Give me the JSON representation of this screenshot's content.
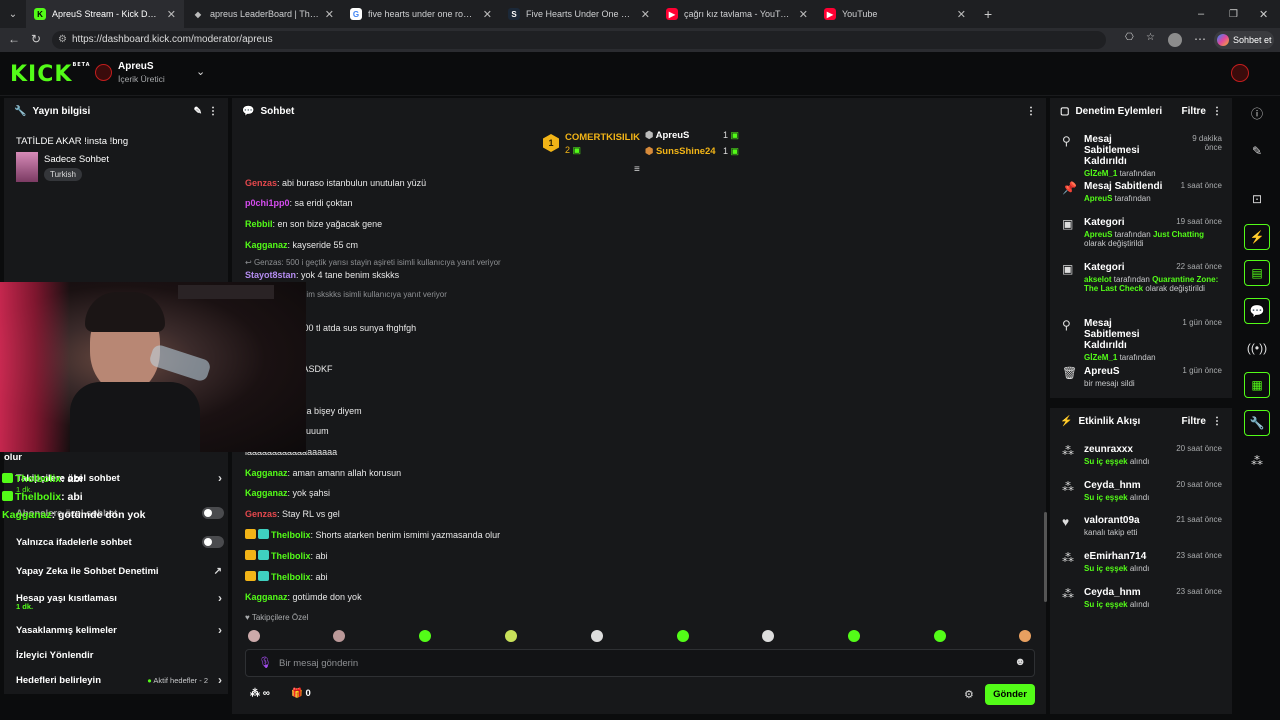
{
  "tabs": [
    {
      "title": "ApreuS Stream - Kick Dashboard",
      "icon": "kick-icon",
      "active": true
    },
    {
      "title": "apreus LeaderBoard | The best Ch",
      "icon": "shield-icon"
    },
    {
      "title": "five hearts under one roof 2 - Goo",
      "icon": "google-icon"
    },
    {
      "title": "Five Hearts Under One Roof seaso",
      "icon": "steam-icon"
    },
    {
      "title": "çağrı kız tavlama - YouTube",
      "icon": "youtube-icon"
    },
    {
      "title": "YouTube",
      "icon": "youtube-icon"
    }
  ],
  "address": {
    "url": "https://dashboard.kick.com/moderator/apreus",
    "chat_button": "Sohbet et"
  },
  "header": {
    "logo": "KICK",
    "beta": "BETA",
    "channel": "ApreuS",
    "role": "İçerik Üretici"
  },
  "stream_info": {
    "title": "Yayın bilgisi",
    "stream_title": "TATİLDE AKAR !insta !bng",
    "category": "Sadece Sohbet",
    "tag": "Turkish"
  },
  "settings": {
    "overlay_lines": [
      "olur",
      "Takipçilere özel sohbet",
      "1 dk.",
      "Abonelere özel sohbet"
    ],
    "overlay_chat": [
      {
        "user": "Thelbolix",
        "text": ": abi"
      },
      {
        "user": "Thelbolix",
        "text": ": abi"
      },
      {
        "user": "Kagganaz",
        "text": ": gotümde don yok"
      }
    ],
    "emote_only": "Yalnızca ifadelerle sohbet",
    "ai_mod": "Yapay Zeka ile Sohbet Denetimi",
    "account_age": "Hesap yaşı kısıtlaması",
    "account_age_value": "1 dk.",
    "banned_words": "Yasaklanmış kelimeler",
    "viewer_redirect": "İzleyici Yönlendir",
    "goals": "Hedefleri belirleyin",
    "goals_status": "Aktif hedefler - 2"
  },
  "chat": {
    "title": "Sohbet",
    "leaderboard": {
      "rank": "1",
      "top_user": "COMERTKISILIK",
      "top_count": "2",
      "u2": "ApreuS",
      "u2_count": "1",
      "u3": "SunsShine24",
      "u3_count": "1"
    },
    "messages": [
      {
        "user": "Genzas",
        "color": "#e5484d",
        "text": ": abi buraso istanbulun unutulan yüzü"
      },
      {
        "user": "p0chi1pp0",
        "color": "#d64cf0",
        "text": ": sa eridi çoktan"
      },
      {
        "user": "Rebbil",
        "color": "#53fc18",
        "text": ": en son bize yağacak gene"
      },
      {
        "user": "Kagganaz",
        "color": "#53fc18",
        "text": ": kayseride 55 cm"
      },
      {
        "reply": "Genzas: 500 i geçtik yarısı stayin aşireti isimli kullanıcıya yanıt veriyor"
      },
      {
        "user": "Stayot8stan",
        "color": "#b48cf0",
        "text": ": yok 4 tane benim skskks"
      },
      {
        "reply": "yok 4 tane benim skskks isimli kullanıcıya yanıt veriyor"
      },
      {
        "user": "",
        "color": "#fff",
        "text": "SKSKSK"
      },
      {
        "user": "",
        "color": "#fff",
        "text": "elim şuna 50.000 tl atda sus sunya fhghfgh"
      },
      {
        "user": "",
        "color": "#fff",
        "text": "ksksk"
      },
      {
        "user": "ix",
        "color": "#53fc18",
        "text": ": SADLASJFASDKF"
      },
      {
        "user": "",
        "color": "#fff",
        "text": "ak"
      },
      {
        "user": "ix",
        "color": "#53fc18",
        "text": ": Abi bide sana bişey diyem"
      },
      {
        "user": "",
        "color": "#fff",
        "text": "diyoooooo oluuuuum"
      },
      {
        "user": "",
        "color": "#fff",
        "text": "laaaaaaaaaaaaaaaaaa"
      },
      {
        "user": "Kagganaz",
        "color": "#53fc18",
        "text": ": aman amann allah korusun"
      },
      {
        "user": "Kagganaz",
        "color": "#53fc18",
        "text": ": yok şahsi"
      },
      {
        "user": "Genzas",
        "color": "#e5484d",
        "text": ": Stay RL vs gel"
      },
      {
        "user": "Thelbolix",
        "color": "#53fc18",
        "text": ": Shorts atarken benim ismimi yazmasanda olur",
        "badges": true
      },
      {
        "user": "Thelbolix",
        "color": "#53fc18",
        "text": ": abi",
        "badges": true
      },
      {
        "user": "Thelbolix",
        "color": "#53fc18",
        "text": ": abi",
        "badges": true
      },
      {
        "user": "Kagganaz",
        "color": "#53fc18",
        "text": ": gotümde don yok"
      }
    ],
    "followers_only": "Takipçilere Özel",
    "input_placeholder": "Bir mesaj gönderin",
    "points": "∞",
    "gift_count": "0",
    "send": "Gönder"
  },
  "mod_actions": {
    "title": "Denetim Eylemleri",
    "filter": "Filtre",
    "items": [
      {
        "title": "Mesaj Sabitlemesi Kaldırıldı",
        "time": "9 dakika önce",
        "by": "GİZeM_1",
        "by_suffix": " tarafından",
        "icon": "unpin-icon"
      },
      {
        "title": "Mesaj Sabitlendi",
        "time": "1 saat önce",
        "by": "ApreuS",
        "by_suffix": " tarafından",
        "icon": "pin-icon"
      },
      {
        "title": "Kategori",
        "time": "19 saat önce",
        "by": "ApreuS",
        "by_suffix": " tarafından ",
        "cat": "Just Chatting",
        "tail": " olarak değiştirildi",
        "icon": "category-icon"
      },
      {
        "title": "Kategori",
        "time": "22 saat önce",
        "by": "akselot",
        "by_suffix": " tarafından ",
        "cat": "Quarantine Zone: The Last Check",
        "tail": " olarak değiştirildi",
        "icon": "category-icon"
      },
      {
        "title": "Mesaj Sabitlemesi Kaldırıldı",
        "time": "1 gün önce",
        "by": "GİZeM_1",
        "by_suffix": " tarafından",
        "icon": "unpin-icon"
      },
      {
        "title": "ApreuS",
        "time": "1 gün önce",
        "desc": "bir mesajı sildi",
        "icon": "trash-icon"
      }
    ]
  },
  "activity": {
    "title": "Etkinlik Akışı",
    "filter": "Filtre",
    "items": [
      {
        "user": "zeunraxxx",
        "time": "20 saat önce",
        "action": "Su iç eşşek",
        "suffix": " alındı"
      },
      {
        "user": "Ceyda_hnm",
        "time": "20 saat önce",
        "action": "Su iç eşşek",
        "suffix": " alındı"
      },
      {
        "user": "valorant09a",
        "time": "21 saat önce",
        "action": "",
        "suffix": "kanalı takip etti"
      },
      {
        "user": "eEmirhan714",
        "time": "23 saat önce",
        "action": "Su iç eşşek",
        "suffix": " alındı"
      },
      {
        "user": "Ceyda_hnm",
        "time": "23 saat önce",
        "action": "Su iç eşşek",
        "suffix": " alındı"
      }
    ]
  }
}
